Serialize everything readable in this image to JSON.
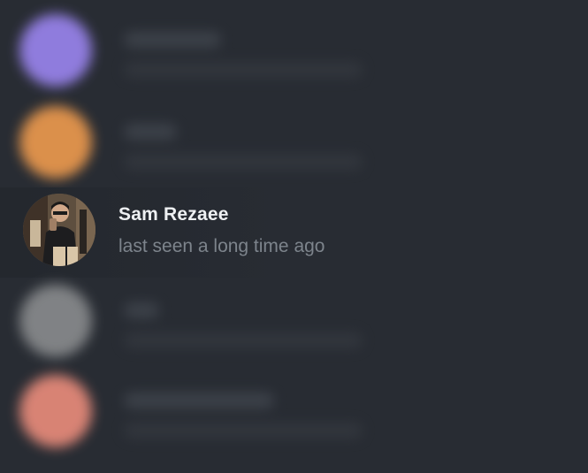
{
  "contacts": [
    {
      "name": "",
      "status": "",
      "avatar_color": "#9b85f0",
      "blurred": true
    },
    {
      "name": "",
      "status": "",
      "avatar_color": "#ef9b4e",
      "blurred": true
    },
    {
      "name": "Sam Rezaee",
      "status": "last seen a long time ago",
      "avatar_color": "#6a5b4a",
      "blurred": false
    },
    {
      "name": "",
      "status": "",
      "avatar_color": "#8a8c8e",
      "blurred": true
    },
    {
      "name": "",
      "status": "",
      "avatar_color": "#ec8d7c",
      "blurred": true
    }
  ],
  "colors": {
    "background": "#282c33",
    "name_text": "#eef0f2",
    "status_text": "#7d848c"
  }
}
